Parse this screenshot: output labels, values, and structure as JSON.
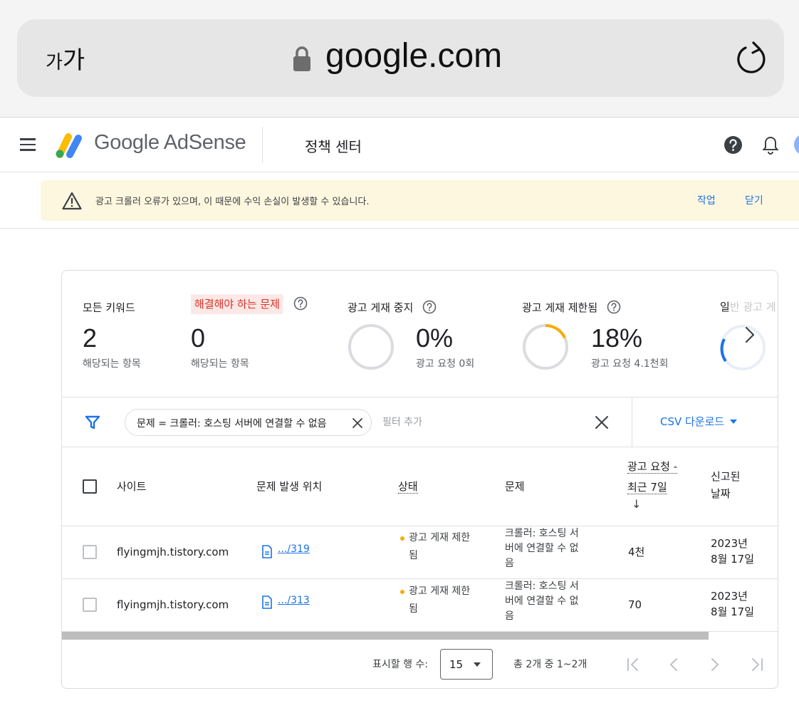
{
  "browser": {
    "text_size_label_small": "가",
    "text_size_label_large": "가",
    "url": "google.com"
  },
  "header": {
    "logo_text": "Google AdSense",
    "section_title": "정책 센터"
  },
  "banner": {
    "message": "광고 크롤러 오류가 있으며, 이 때문에 수익 손실이 발생할 수 있습니다.",
    "action_label": "작업",
    "close_label": "닫기"
  },
  "summary": {
    "all_keywords": {
      "label": "모든 키워드",
      "value": "2",
      "sub": "해당되는 항목"
    },
    "issues_to_fix": {
      "label": "해결해야 하는 문제",
      "value": "0",
      "sub": "해당되는 항목"
    },
    "ad_serving_disabled": {
      "label": "광고 게재 중지",
      "percent": "0%",
      "sub": "광고 요청 0회",
      "fraction": 0
    },
    "ad_serving_limited": {
      "label": "광고 게재 제한됨",
      "percent": "18%",
      "sub": "광고 요청 4.1천회",
      "fraction": 0.18
    },
    "general_ads_label_visible": "일",
    "general_ads_label_faded": "반 광고 게"
  },
  "filter": {
    "chip_text": "문제 = 크롤러: 호스팅 서버에 연결할 수 없음",
    "add_placeholder": "필터 추가",
    "csv_label": "CSV 다운로드"
  },
  "table": {
    "columns": {
      "site": "사이트",
      "location": "문제 발생 위치",
      "status": "상태",
      "issue": "문제",
      "requests_line1": "광고 요청 -",
      "requests_line2": "최근 7일",
      "sort_arrow": "↓",
      "reported_line1": "신고된",
      "reported_line2": "날짜"
    },
    "rows": [
      {
        "site": "flyingmjh.tistory.com",
        "location": ".../319",
        "status_line1": "광고 게재 제한",
        "status_line2": "됨",
        "issue_line1": "크롤러: 호스팅 서",
        "issue_line2": "버에 연결할 수 없",
        "issue_line3": "음",
        "requests": "4천",
        "date_line1": "2023년",
        "date_line2": "8월 17일"
      },
      {
        "site": "flyingmjh.tistory.com",
        "location": ".../313",
        "status_line1": "광고 게재 제한",
        "status_line2": "됨",
        "issue_line1": "크롤러: 호스팅 서",
        "issue_line2": "버에 연결할 수 없",
        "issue_line3": "음",
        "requests": "70",
        "date_line1": "2023년",
        "date_line2": "8월 17일"
      }
    ]
  },
  "pagination": {
    "rows_label": "표시할 행 수:",
    "rows_value": "15",
    "range_text": "총 2개 중 1~2개"
  },
  "colors": {
    "accent_blue": "#1a73e8",
    "warning_bg": "#fef7e0",
    "error_red": "#d93025",
    "status_amber": "#f9ab00"
  }
}
